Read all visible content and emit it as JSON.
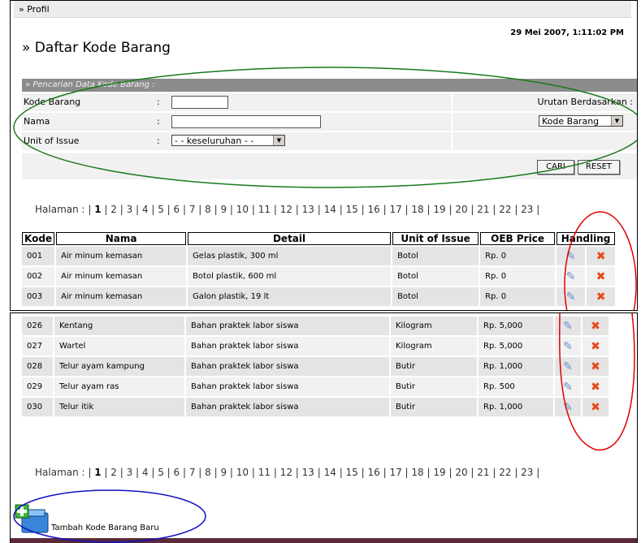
{
  "breadcrumb": "» Profil",
  "timestamp": "29 Mei 2007, 1:11:02 PM",
  "title": "» Daftar Kode Barang",
  "search": {
    "header": "» Pencarian Data Kode Barang :",
    "kode_label": "Kode Barang",
    "nama_label": "Nama",
    "uoi_label": "Unit of Issue",
    "colon": ":",
    "uoi_value": "- - keseluruhan - -",
    "sort_label": "Urutan Berdasarkan :",
    "sort_value": "Kode Barang",
    "cari_label": "CARI",
    "reset_label": "RESET"
  },
  "pager": {
    "label": "Halaman :",
    "current": "1",
    "pages": [
      "2",
      "3",
      "4",
      "5",
      "6",
      "7",
      "8",
      "9",
      "10",
      "11",
      "12",
      "13",
      "14",
      "15",
      "16",
      "17",
      "18",
      "19",
      "20",
      "21",
      "22",
      "23"
    ]
  },
  "table": {
    "headers": [
      "Kode",
      "Nama",
      "Detail",
      "Unit of Issue",
      "OEB Price",
      "Handling"
    ],
    "rows_top": [
      [
        "001",
        "Air minum kemasan",
        "Gelas plastik, 300 ml",
        "Botol",
        "Rp. 0"
      ],
      [
        "002",
        "Air minum kemasan",
        "Botol plastik, 600 ml",
        "Botol",
        "Rp. 0"
      ],
      [
        "003",
        "Air minum kemasan",
        "Galon plastik, 19 lt",
        "Botol",
        "Rp. 0"
      ]
    ],
    "rows_bottom": [
      [
        "026",
        "Kentang",
        "Bahan praktek labor siswa",
        "Kilogram",
        "Rp. 5,000"
      ],
      [
        "027",
        "Wartel",
        "Bahan praktek labor siswa",
        "Kilogram",
        "Rp. 5,000"
      ],
      [
        "028",
        "Telur ayam kampung",
        "Bahan praktek labor siswa",
        "Butir",
        "Rp. 1,000"
      ],
      [
        "029",
        "Telur ayam ras",
        "Bahan praktek labor siswa",
        "Butir",
        "Rp. 500"
      ],
      [
        "030",
        "Telur itik",
        "Bahan praktek labor siswa",
        "Butir",
        "Rp. 1,000"
      ]
    ]
  },
  "add_label": "Tambah Kode Barang Baru",
  "icons": {
    "edit": "edit-pencil-icon",
    "delete": "delete-x-icon",
    "add": "add-folder-icon"
  },
  "colors": {
    "green": "#1a7a1a",
    "red": "#e00000",
    "blue": "#1010c0",
    "header_gray": "#8c8c8c"
  }
}
